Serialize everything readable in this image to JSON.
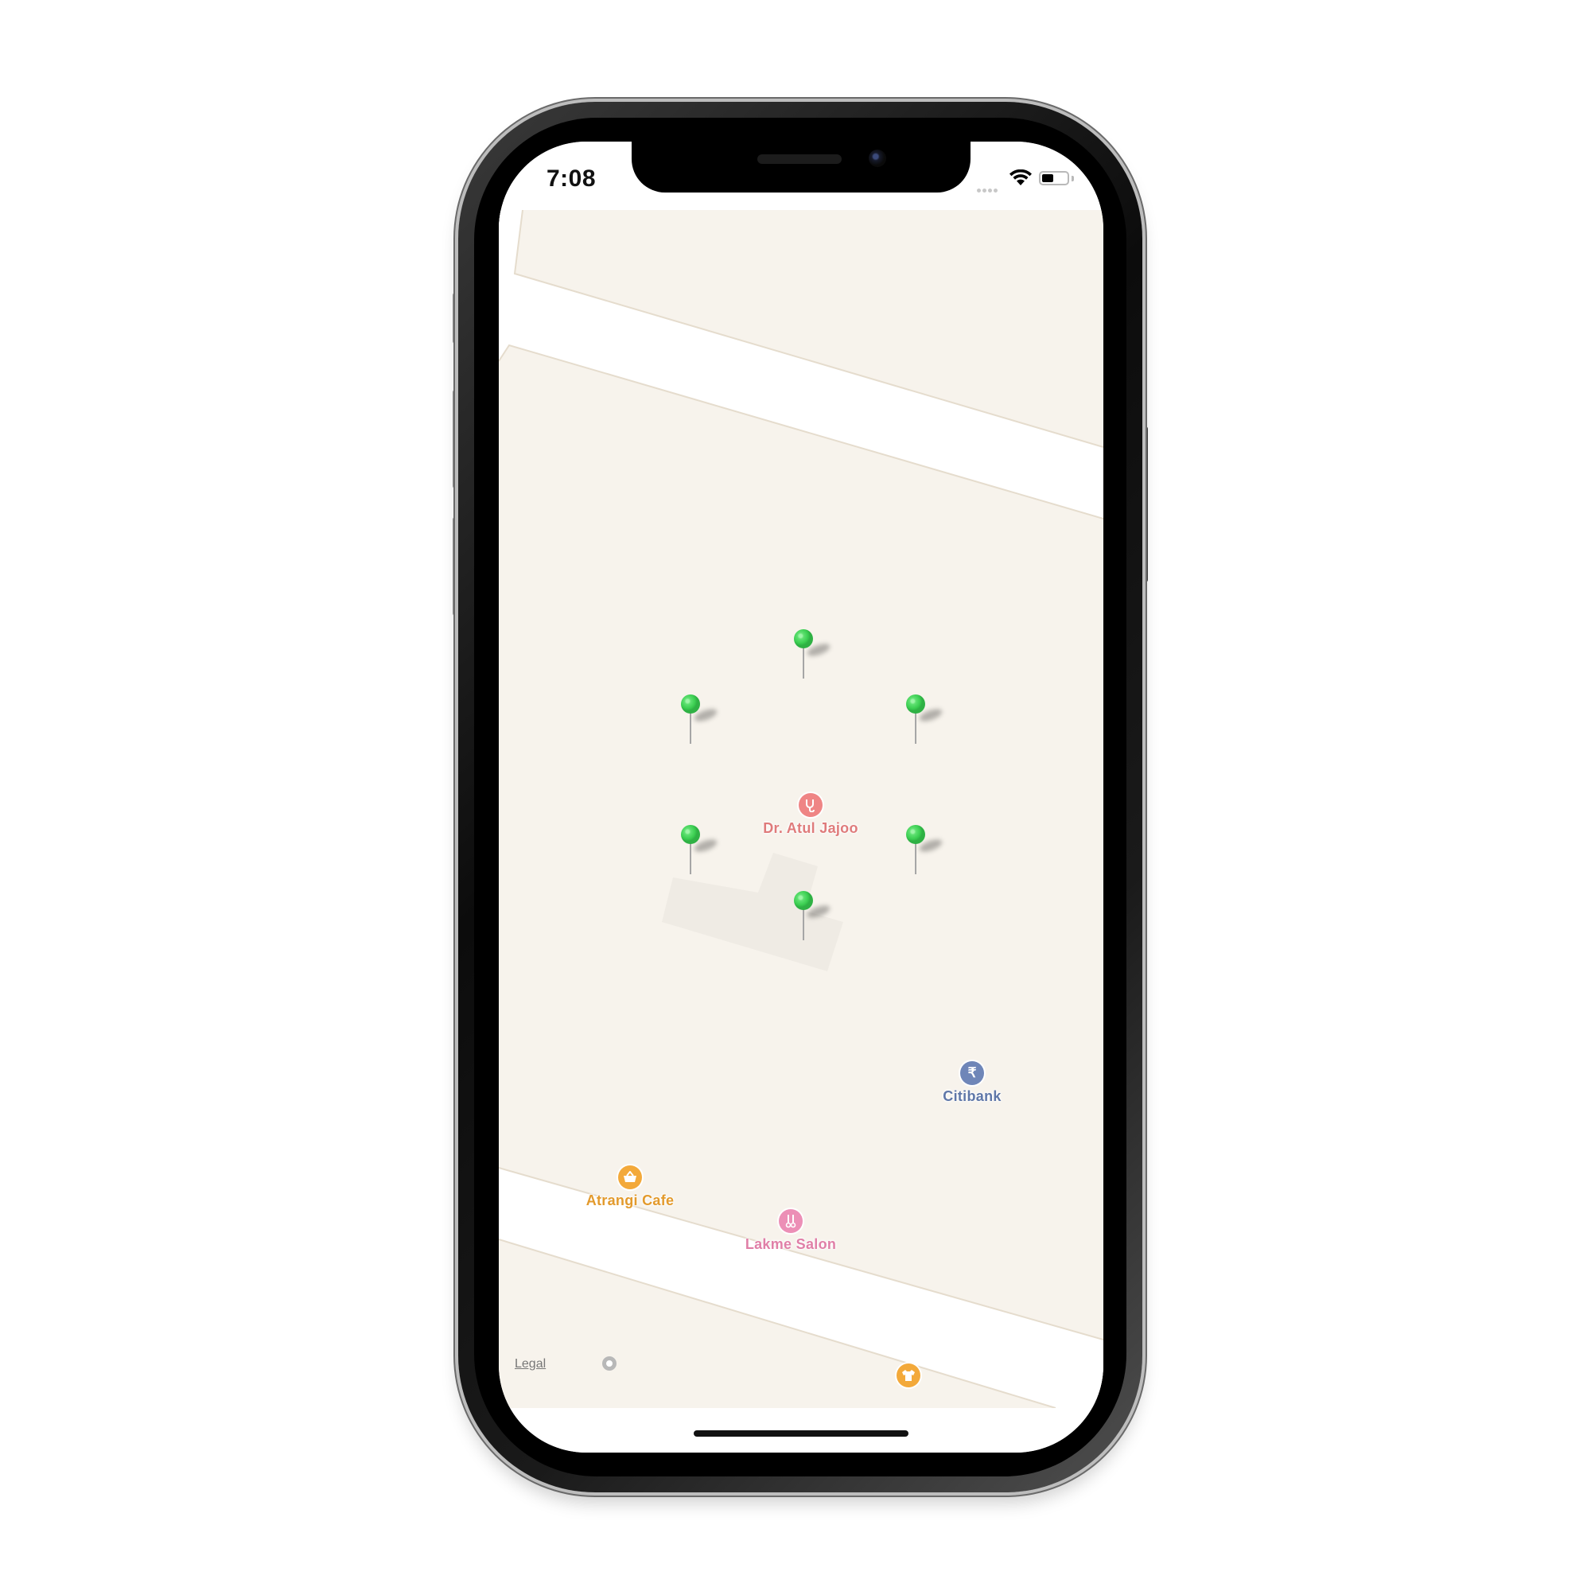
{
  "status_bar": {
    "time": "7:08",
    "signal_icon": "cellular-signal-icon",
    "wifi_icon": "wifi-icon",
    "battery_icon": "battery-icon",
    "battery_level": 0.45
  },
  "map": {
    "pins": [
      {
        "name": "pin-1",
        "color": "#3ccf52"
      },
      {
        "name": "pin-2",
        "color": "#3ccf52"
      },
      {
        "name": "pin-3",
        "color": "#3ccf52"
      },
      {
        "name": "pin-4",
        "color": "#3ccf52"
      },
      {
        "name": "pin-5",
        "color": "#3ccf52"
      },
      {
        "name": "pin-6",
        "color": "#3ccf52"
      }
    ],
    "places": {
      "doctor": {
        "label": "Dr. Atul Jajoo",
        "icon": "stethoscope-icon",
        "color": "#ef8585"
      },
      "bank": {
        "label": "Citibank",
        "icon": "rupee-icon",
        "color": "#6f86b8"
      },
      "cafe": {
        "label": "Atrangi Cafe",
        "icon": "basket-icon",
        "color": "#f3a93a"
      },
      "salon": {
        "label": "Lakme Salon",
        "icon": "scissors-icon",
        "color": "#ec8fb6"
      },
      "shop": {
        "icon": "tshirt-icon",
        "color": "#f3a93a"
      }
    },
    "legal": "Legal",
    "land_color": "#f7f3ec",
    "road_color": "#ffffff",
    "building_color": "#efebe4"
  }
}
